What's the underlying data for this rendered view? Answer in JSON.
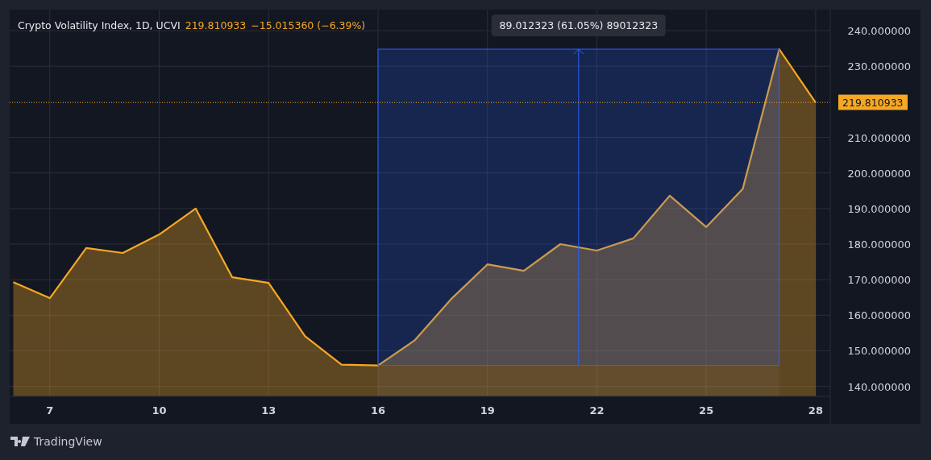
{
  "header": {
    "title": "Crypto Volatility Index, 1D, UCVI",
    "price": "219.810933",
    "change": "−15.015360 (−6.39%)"
  },
  "chart": {
    "chart_data": {
      "type": "area",
      "grid": true,
      "x": [
        6,
        7,
        8,
        9,
        10,
        11,
        12,
        13,
        14,
        15,
        16,
        17,
        18,
        19,
        20,
        21,
        22,
        23,
        24,
        25,
        26,
        27,
        28
      ],
      "series": [
        {
          "color": "#f7a823",
          "values": [
            169.3,
            164.8,
            178.9,
            177.5,
            182.7,
            190.0,
            170.7,
            169.1,
            154.1,
            146.1,
            145.9,
            152.9,
            164.5,
            174.3,
            172.5,
            180.0,
            178.2,
            181.6,
            193.6,
            184.8,
            195.5,
            234.8,
            219.8
          ]
        }
      ],
      "xlim": [
        5.9,
        28.4
      ],
      "ylim": [
        137.2,
        245.9
      ],
      "xticks": [
        7,
        10,
        13,
        16,
        19,
        22,
        25,
        28
      ],
      "yticks": [
        {
          "value": 140,
          "label": "140.000000"
        },
        {
          "value": 150,
          "label": "150.000000"
        },
        {
          "value": 160,
          "label": "160.000000"
        },
        {
          "value": 170,
          "label": "170.000000"
        },
        {
          "value": 180,
          "label": "180.000000"
        },
        {
          "value": 190,
          "label": "190.000000"
        },
        {
          "value": 200,
          "label": "200.000000"
        },
        {
          "value": 210,
          "label": "210.000000"
        },
        {
          "value": 230,
          "label": "230.000000"
        },
        {
          "value": 240,
          "label": "240.000000"
        }
      ],
      "bands": [
        {
          "axis": "x",
          "from": 16,
          "to": 27,
          "color": "#2962ff"
        }
      ],
      "ref_lines": [
        {
          "axis": "x",
          "value": 21.5,
          "color": "#2962ff"
        },
        {
          "axis": "y",
          "value": 219.810933,
          "label": "219.810933",
          "color": "#f7a823"
        }
      ]
    },
    "measurement_label": "89.012323 (61.05%) 89012323"
  },
  "footer": {
    "brand": "TradingView"
  }
}
